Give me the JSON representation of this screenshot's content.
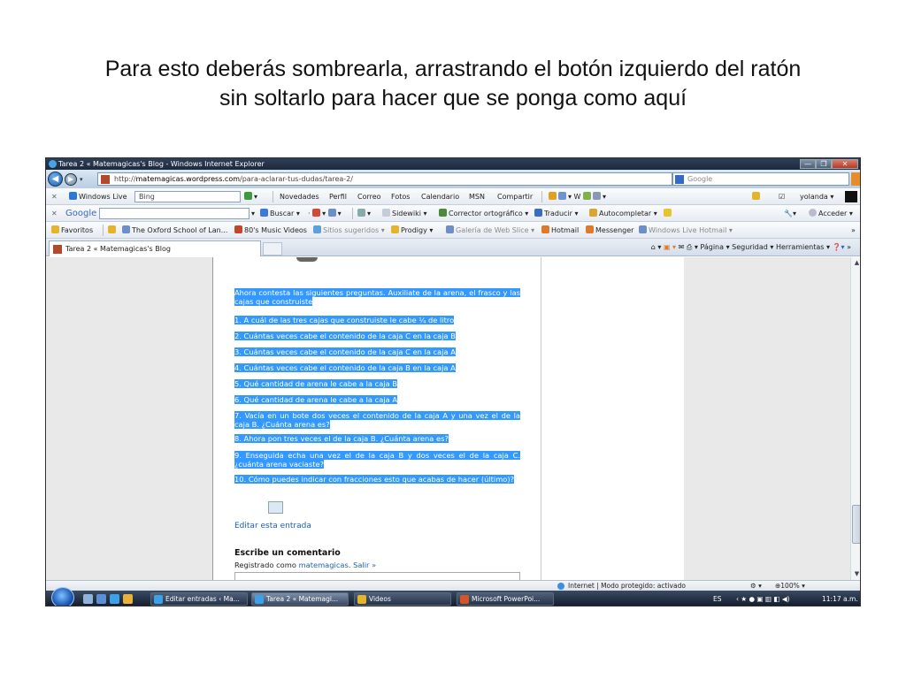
{
  "slide": {
    "title_line1": "Para esto deberás sombrearla, arrastrando el botón izquierdo del ratón",
    "title_line2": "sin soltarlo para hacer que se ponga como aquí"
  },
  "window": {
    "title": "Tarea 2 « Matemagicas's Blog - Windows Internet Explorer",
    "controls": [
      "—",
      "❐",
      "✕"
    ]
  },
  "address": {
    "url_prefix": "http://",
    "url_domain": "matemagicas.wordpress.com",
    "url_path": "/para-aclarar-tus-dudas/tarea-2/",
    "search_placeholder": "Google"
  },
  "toolbar_live": {
    "brand": "Windows Live",
    "search_value": "Bing",
    "links": [
      "Novedades",
      "Perfil",
      "Correo",
      "Fotos",
      "Calendario",
      "MSN",
      "Compartir"
    ],
    "user": "yolanda ▾"
  },
  "toolbar_google": {
    "brand": "Google",
    "buscar": "Buscar ▾",
    "sidewiki": "Sidewiki ▾",
    "corrector": "Corrector ortográfico ▾",
    "traducir": "Traducir ▾",
    "autocompletar": "Autocompletar ▾",
    "acceder": "Acceder ▾"
  },
  "favorites_bar": {
    "label": "Favoritos",
    "items": [
      "The Oxford School of Lan...",
      "80's Music Videos",
      "Sitios sugeridos ▾",
      "Prodigy ▾",
      "Galería de Web Slice ▾",
      "Hotmail",
      "Messenger",
      "Windows Live Hotmail ▾"
    ]
  },
  "tabs": {
    "active": "Tarea 2 « Matemagicas's Blog",
    "commands": "Página ▾   Seguridad ▾   Herramientas ▾"
  },
  "post": {
    "paragraphs": [
      "Ahora contesta las siguientes preguntas. Auxiliate de la arena, el frasco y las cajas que construiste",
      "1. A cuál de las tres cajas que construiste le cabe ¼ de litro",
      "2. Cuántas veces cabe el contenido de la caja C en la caja B",
      "3. Cuántas veces cabe el contenido de la caja C en la caja A",
      "4. Cuántas veces cabe el contenido de la caja B en la caja A",
      "5. Qué cantidad de arena le cabe a la caja B",
      "6. Qué cantidad de arena le cabe a la caja A",
      "7. Vacía en un bote dos veces el contenido de la caja A y una vez el de la caja B. ¿Cuánta arena es?",
      "8. Ahora pon tres veces el de la caja B. ¿Cuánta arena es?",
      "9. Enseguida echa una vez el de la caja B y dos veces el de la caja C. ¿cuánta arena vaciaste?",
      "10. Cómo puedes indicar con fracciones esto que acabas de hacer (último)?"
    ],
    "edit_link": "Editar esta entrada",
    "comment_heading": "Escribe un comentario",
    "registered_as": "Registrado como",
    "registered_user": "matemagicas",
    "logout": "Salir »"
  },
  "status": {
    "zone": "Internet | Modo protegido: activado",
    "zoom": "⊕100% ▾"
  },
  "taskbar": {
    "tasks": [
      "Editar entradas ‹ Ma...",
      "Tarea 2 « Matemagi...",
      "Videos",
      "Microsoft PowerPoi..."
    ],
    "lang": "ES",
    "time": "11:17 a.m."
  }
}
